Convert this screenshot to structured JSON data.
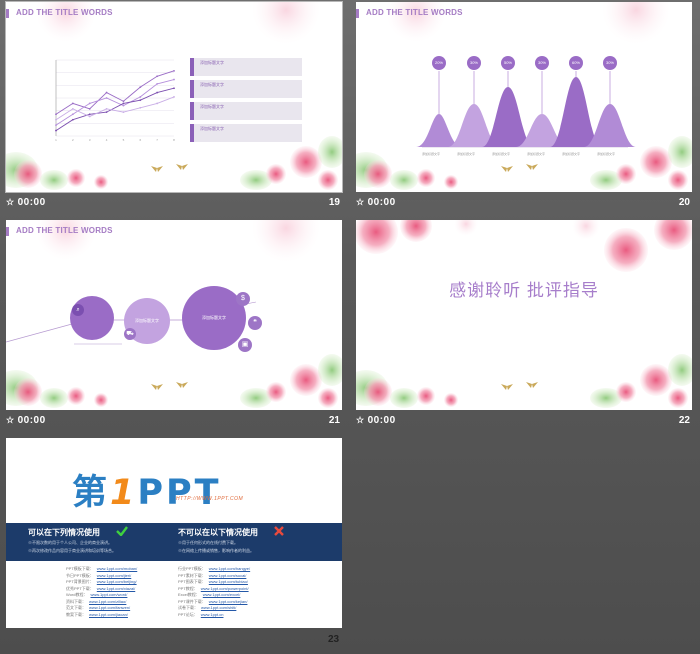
{
  "colors": {
    "accent": "#9a6cc6",
    "light_accent": "#c7a9df",
    "band": "#1c3b6a"
  },
  "slides": [
    {
      "title": "ADD THE TITLE WORDS",
      "time": "00:00",
      "number": "19",
      "legend": [
        "添加标题文字",
        "添加标题文字",
        "添加标题文字",
        "添加标题文字"
      ],
      "chart_data": {
        "type": "line",
        "categories": [
          "1",
          "2",
          "3",
          "4",
          "5",
          "6",
          "7",
          "8"
        ],
        "series": [
          {
            "values": [
              2,
              3,
              2.5,
              4,
              3.2,
              4.5,
              5.5,
              6
            ]
          },
          {
            "values": [
              1,
              2,
              3,
              3.5,
              2.8,
              3.6,
              4.8,
              5.2
            ]
          },
          {
            "values": [
              0.5,
              1.5,
              2,
              2.2,
              3,
              3.3,
              4,
              4.4
            ]
          },
          {
            "values": [
              1.5,
              2.5,
              1.8,
              2.5,
              2.2,
              2.6,
              3,
              3.6
            ]
          }
        ],
        "ylim": [
          0,
          7
        ]
      }
    },
    {
      "title": "ADD THE TITLE WORDS",
      "time": "00:00",
      "number": "20",
      "percents": [
        "20%",
        "30%",
        "50%",
        "30%",
        "60%",
        "30%"
      ],
      "captions": [
        "添加标题文字",
        "添加标题文字",
        "添加标题文字",
        "添加标题文字",
        "添加标题文字",
        "添加标题文字"
      ]
    },
    {
      "title": "ADD THE TITLE WORDS",
      "time": "00:00",
      "number": "21",
      "circle_texts": [
        "添加标题文字",
        "添加标题文字"
      ],
      "icons": [
        "$",
        "❝",
        "▣"
      ]
    },
    {
      "time": "00:00",
      "number": "22",
      "thanks": "感谢聆听 批评指导"
    },
    {
      "number": "23",
      "logo_left": "第",
      "logo_one": "1",
      "logo_right": "PPT",
      "logo_url": "HTTP://WWW.1PPT.COM",
      "can_title": "可以在下列情况使用",
      "cannot_title": "不可以在以下情况使用",
      "can_rules": [
        "※不限次数的用于个人公司、企业的商业演讲。",
        "※再次修改作品内容用于商业演讲和培训等场合。"
      ],
      "cannot_rules": [
        "※用于任何形式的在线付费下载。",
        "※在网络上传播或销售，影响作者的利益。"
      ],
      "links_left": [
        [
          "PPT模板下载：",
          "www.1ppt.com/moban/"
        ],
        [
          "节日PPT模板：",
          "www.1ppt.com/jieri/"
        ],
        [
          "PPT背景图片：",
          "www.1ppt.com/beijing/"
        ],
        [
          "优秀PPT下载：",
          "www.1ppt.com/xiazai/"
        ],
        [
          "Word教程：",
          "www.1ppt.com/word/"
        ],
        [
          "资料下载：",
          "www.1ppt.com/ziliao/"
        ],
        [
          "范文下载：",
          "www.1ppt.com/fanwen/"
        ],
        [
          "教案下载：",
          "www.1ppt.com/jiaoan/"
        ]
      ],
      "links_right": [
        [
          "行业PPT模板：",
          "www.1ppt.com/hangye/"
        ],
        [
          "PPT素材下载：",
          "www.1ppt.com/sucai/"
        ],
        [
          "PPT图表下载：",
          "www.1ppt.com/tubiao/"
        ],
        [
          "PPT教程：",
          "www.1ppt.com/powerpoint/"
        ],
        [
          "Excel教程：",
          "www.1ppt.com/excel/"
        ],
        [
          "PPT课件下载：",
          "www.1ppt.com/kejian/"
        ],
        [
          "试卷下载：",
          "www.1ppt.com/shiti/"
        ],
        [
          "PPT论坛：",
          "www.1ppt.cn"
        ]
      ]
    }
  ]
}
